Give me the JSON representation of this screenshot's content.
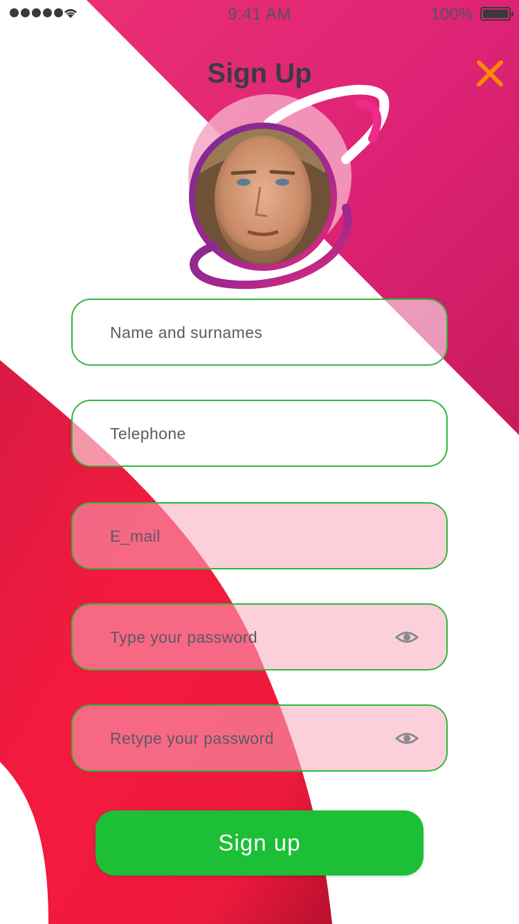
{
  "status_bar": {
    "time": "9:41 AM",
    "battery": "100%"
  },
  "header": {
    "title": "Sign Up",
    "close_icon": "close-icon"
  },
  "avatar": {
    "icon": "user-avatar"
  },
  "form": {
    "name_placeholder": "Name and surnames",
    "telephone_placeholder": "Telephone",
    "email_placeholder": "E_mail",
    "password_placeholder": "Type your password",
    "retype_password_placeholder": "Retype your password",
    "eye_icon": "eye-icon",
    "submit_label": "Sign up"
  },
  "colors": {
    "accent_pink": "#e0266e",
    "accent_red": "#f0183c",
    "field_border": "#30b83a",
    "button_green": "#1cbf35",
    "close_orange": "#ff8a00",
    "title_text": "#3b3b45"
  }
}
